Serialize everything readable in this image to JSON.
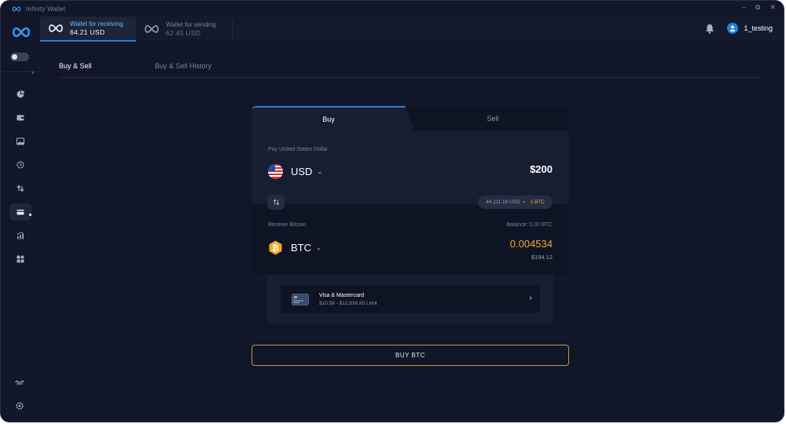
{
  "app": {
    "title": "Infinity Wallet"
  },
  "window_controls": {
    "minimize": "–",
    "restore": "⧉",
    "close": "✕"
  },
  "header": {
    "wallets": [
      {
        "name": "Wallet for receiving",
        "balance": "64.21 USD"
      },
      {
        "name": "Wallet for sending",
        "balance": "62.45 USD"
      }
    ],
    "user": {
      "name": "1_testing"
    }
  },
  "sidebar": {
    "collapse_glyph": "›",
    "items": [
      {
        "icon": "pie-chart-icon"
      },
      {
        "icon": "wallet-icon"
      },
      {
        "icon": "image-icon"
      },
      {
        "icon": "history-icon"
      },
      {
        "icon": "exchange-icon"
      },
      {
        "icon": "credit-card-icon"
      },
      {
        "icon": "bar-chart-icon"
      },
      {
        "icon": "apps-icon"
      }
    ],
    "bottom_icons": [
      "link-icon",
      "gear-icon"
    ]
  },
  "page_tabs": [
    "Buy & Sell",
    "Buy & Sell History"
  ],
  "trade": {
    "tabs": {
      "buy": "Buy",
      "sell": "Sell"
    },
    "pay_label": "Pay United States Dollar",
    "pay_currency": "USD",
    "pay_amount": "$200",
    "rate": {
      "fiat": "44,111.16 USD",
      "equals": "=",
      "crypto": "1 BTC"
    },
    "receive_label": "Receive Bitcoin",
    "balance": "Balance: 0.00 BTC",
    "receive_currency": "BTC",
    "receive_amount": "0.004534",
    "receive_usd": "$194.12",
    "chevron": "⌄"
  },
  "payment_method": {
    "title": "Visa & Mastercard",
    "limit": "$10.58 - $12,838.85 Limit",
    "arrow": "›"
  },
  "buy_button": {
    "label": "BUY BTC"
  },
  "colors": {
    "background": "#111628",
    "accent_blue": "#2e7fd9",
    "bitcoin_orange": "#f3a82a",
    "button_border": "#c89a3a"
  }
}
